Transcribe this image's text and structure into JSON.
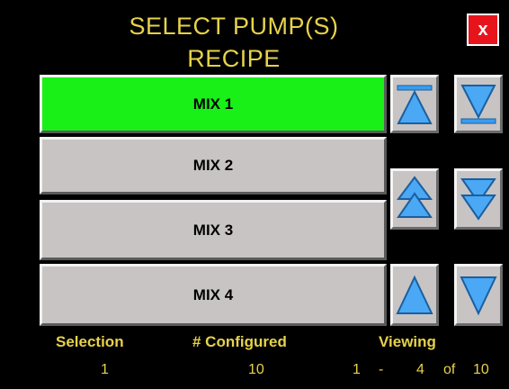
{
  "header": {
    "title_line1": "SELECT PUMP(S)",
    "title_line2": "RECIPE",
    "close_label": "x"
  },
  "recipes": [
    {
      "label": "MIX 1",
      "selected": true
    },
    {
      "label": "MIX 2",
      "selected": false
    },
    {
      "label": "MIX 3",
      "selected": false
    },
    {
      "label": "MIX 4",
      "selected": false
    }
  ],
  "nav_buttons": {
    "top": "jump-to-top-icon",
    "bottom": "jump-to-bottom-icon",
    "page_up": "double-up-icon",
    "page_down": "double-down-icon",
    "line_up": "up-arrow-icon",
    "line_down": "down-arrow-icon"
  },
  "status": {
    "selection_label": "Selection",
    "configured_label": "# Configured",
    "viewing_label": "Viewing",
    "selection_value": "1",
    "configured_value": "10",
    "viewing_from": "1",
    "viewing_dash": "-",
    "viewing_to": "4",
    "viewing_of": "of",
    "viewing_total": "10"
  },
  "colors": {
    "background": "#000000",
    "title_text": "#e6d24a",
    "selected_item": "#18f018",
    "item": "#c8c4c4",
    "close_button": "#e8141c",
    "arrow": "#3a9cf0"
  }
}
